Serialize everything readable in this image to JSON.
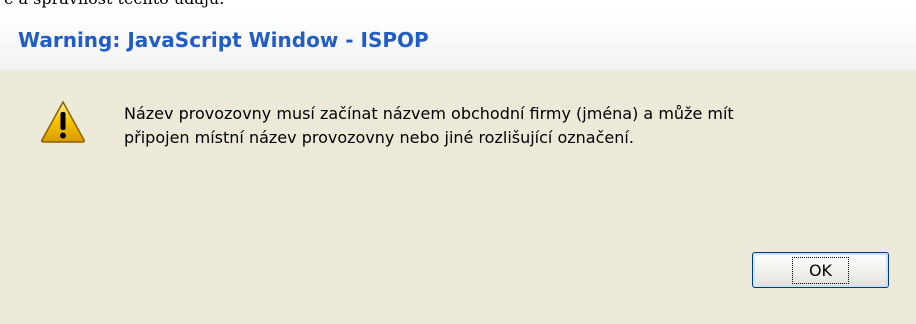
{
  "background_text": "e a správnost těchto údajů.",
  "window": {
    "title": "Warning: JavaScript Window - ISPOP"
  },
  "dialog": {
    "icon": "warning-icon",
    "message_lines": [
      "Název provozovny musí začínat názvem obchodní firmy (jména) a může mít",
      "připojen místní název provozovny nebo jiné rozlišující označení."
    ],
    "ok_label": "OK"
  },
  "colors": {
    "title": "#215dc6",
    "dialog_background": "#ece9d8",
    "warning_fill": "#f7c600",
    "button_border": "#003c74"
  }
}
